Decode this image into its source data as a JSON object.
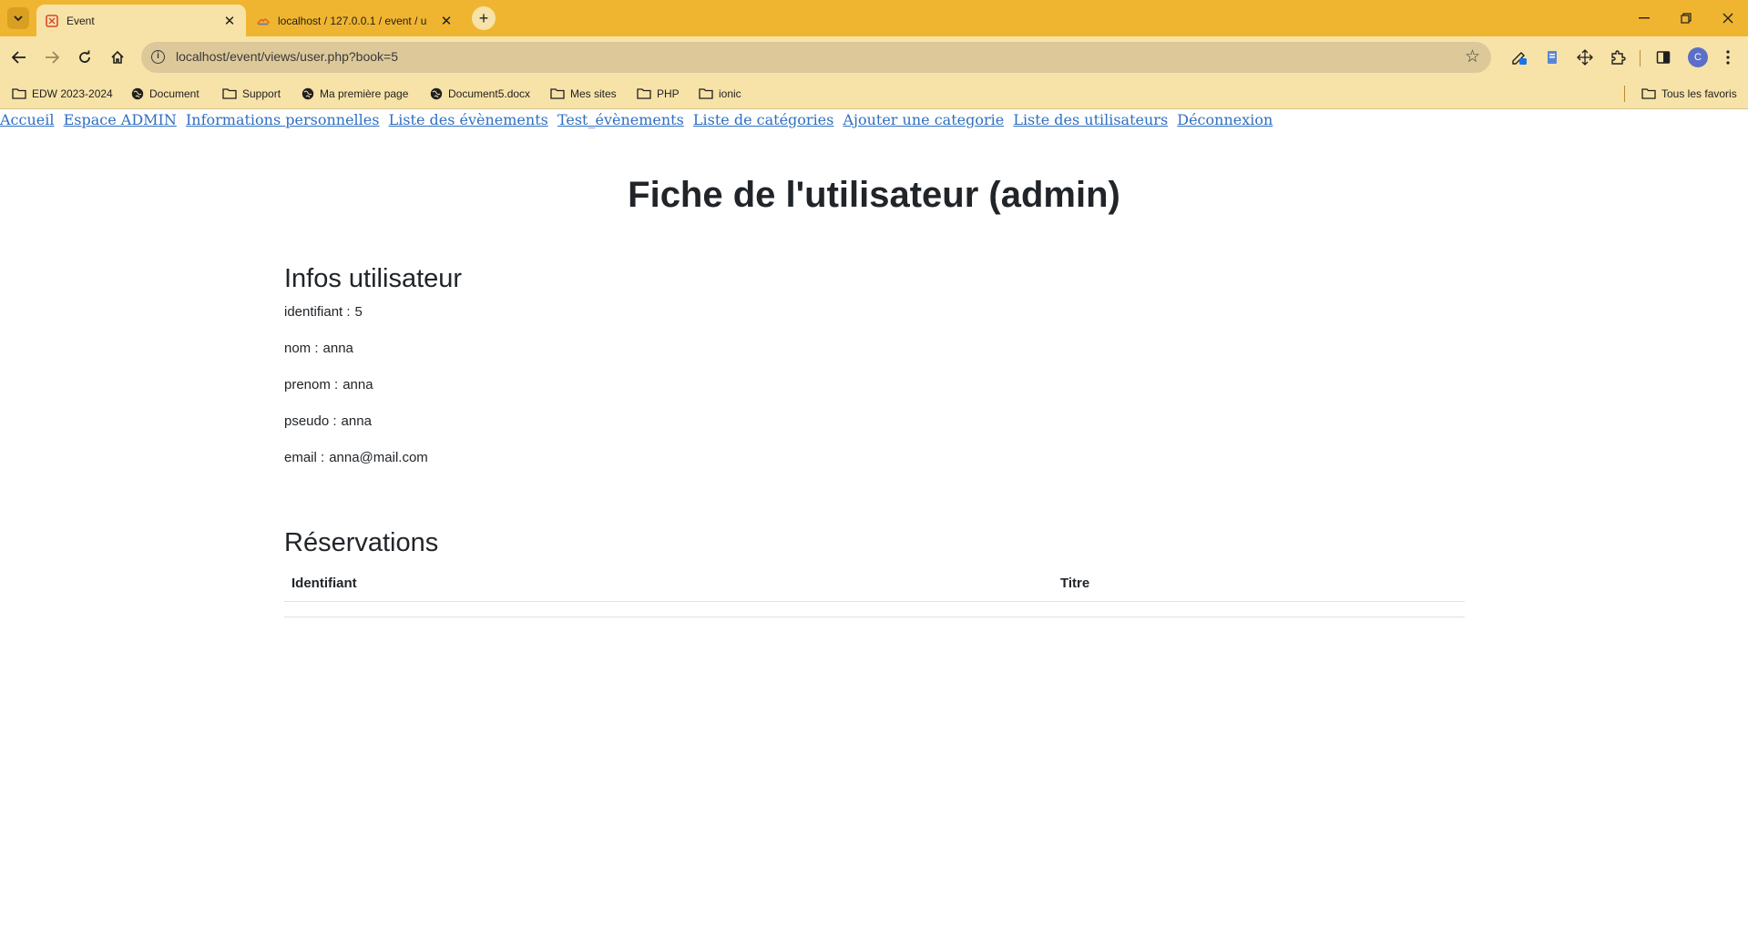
{
  "browser": {
    "tabs": [
      {
        "title": "Event",
        "active": true,
        "favicon": "event-favicon"
      },
      {
        "title": "localhost / 127.0.0.1 / event / u",
        "active": false,
        "favicon": "phpmyadmin-favicon"
      }
    ],
    "address": "localhost/event/views/user.php?book=5",
    "bookmarks": [
      {
        "label": "EDW 2023-2024",
        "icon": "folder-icon"
      },
      {
        "label": "Document",
        "icon": "globe-icon"
      },
      {
        "label": "Support",
        "icon": "folder-icon"
      },
      {
        "label": "Ma première page",
        "icon": "globe-icon"
      },
      {
        "label": "Document5.docx",
        "icon": "globe-icon"
      },
      {
        "label": "Mes sites",
        "icon": "folder-icon"
      },
      {
        "label": "PHP",
        "icon": "folder-icon"
      },
      {
        "label": "ionic",
        "icon": "folder-icon"
      }
    ],
    "favorites_label": "Tous les favoris",
    "profile_initial": "C",
    "accent_color": "#f0b530"
  },
  "nav": {
    "links": [
      "Accueil",
      "Espace ADMIN",
      "Informations personnelles",
      "Liste des évènements",
      "Test_évènements",
      "Liste de catégories",
      "Ajouter une categorie",
      "Liste des utilisateurs",
      "Déconnexion"
    ]
  },
  "page": {
    "title": "Fiche de l'utilisateur (admin)",
    "infos_heading": "Infos utilisateur",
    "fields": [
      {
        "label": "identifiant :",
        "value": "5"
      },
      {
        "label": "nom :",
        "value": "anna"
      },
      {
        "label": "prenom :",
        "value": "anna"
      },
      {
        "label": "pseudo :",
        "value": "anna"
      },
      {
        "label": "email :",
        "value": "anna@mail.com"
      }
    ],
    "reservations_heading": "Réservations",
    "table_headers": [
      "Identifiant",
      "Titre"
    ]
  }
}
